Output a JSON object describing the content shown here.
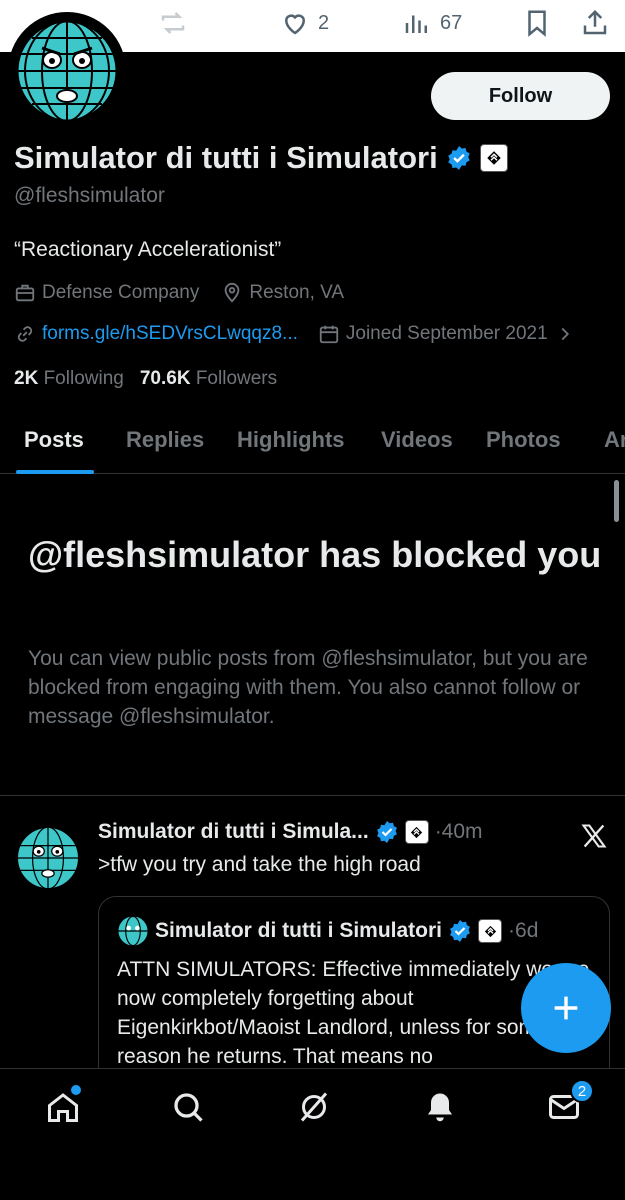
{
  "top_actions": {
    "like_count": "2",
    "views_count": "67"
  },
  "header": {
    "follow_label": "Follow"
  },
  "profile": {
    "name": "Simulator di tutti i Simulatori",
    "handle": "@fleshsimulator",
    "bio": "“Reactionary Accelerationist”",
    "category": "Defense Company",
    "location": "Reston, VA",
    "link": "forms.gle/hSEDVrsCLwqqz8...",
    "joined": "Joined September 2021",
    "following_count": "2K",
    "following_label": "Following",
    "followers_count": "70.6K",
    "followers_label": "Followers"
  },
  "tabs": [
    {
      "label": "Posts"
    },
    {
      "label": "Replies"
    },
    {
      "label": "Highlights"
    },
    {
      "label": "Videos"
    },
    {
      "label": "Photos"
    },
    {
      "label": "Ar"
    }
  ],
  "blocked": {
    "title": "@fleshsimulator has blocked you",
    "description": "You can view public posts from @fleshsimulator, but you are blocked from engaging with them. You also cannot follow or message @fleshsimulator."
  },
  "post": {
    "name": "Simulator di tutti i Simula...",
    "time": "·40m",
    "text": ">tfw you try and take the high road",
    "quote": {
      "name": "Simulator di tutti i Simulatori",
      "time": "·6d",
      "text": "ATTN SIMULATORS: Effective immediately we are now completely forgetting about Eigenkirkbot/Maoist Landlord, unless for some reason he returns. That means no"
    }
  },
  "bottom_nav": {
    "messages_badge": "2"
  },
  "colors": {
    "accent": "#1d9bf0",
    "background": "#000000",
    "muted": "#71767b"
  },
  "icons": [
    "reply-icon",
    "repost-icon",
    "like-icon",
    "views-icon",
    "bookmark-icon",
    "share-icon",
    "verified-icon",
    "affiliation-icon",
    "briefcase-icon",
    "location-icon",
    "link-icon",
    "calendar-icon",
    "chevron-right-icon",
    "x-logo-icon",
    "compose-icon",
    "home-icon",
    "search-icon",
    "grok-icon",
    "bell-icon",
    "mail-icon"
  ]
}
